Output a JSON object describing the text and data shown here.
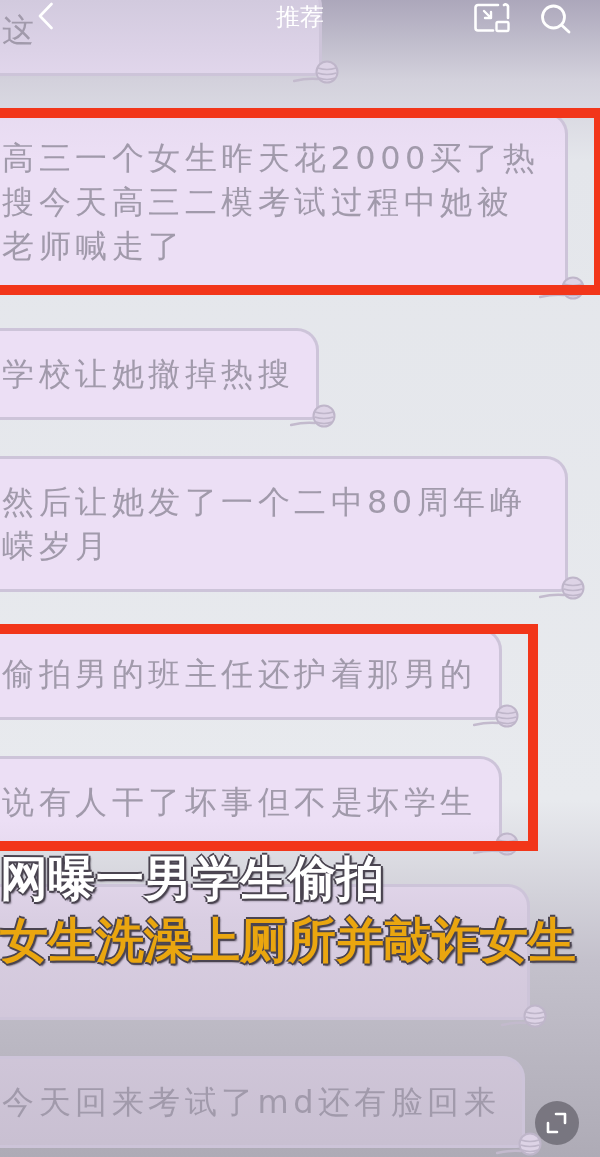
{
  "top_bar": {
    "title": "推荐"
  },
  "sections": [
    {
      "highlighted": false,
      "messages": [
        {
          "kind": "text",
          "text": "这"
        }
      ]
    },
    {
      "highlighted": true,
      "messages": [
        {
          "kind": "text",
          "text": "高三一个女生昨天花2000买了热搜今天高三二模考试过程中她被老师喊走了"
        }
      ]
    },
    {
      "highlighted": false,
      "messages": [
        {
          "kind": "text",
          "text": "学校让她撤掉热搜"
        },
        {
          "kind": "text",
          "text": "然后让她发了一个二中80周年峥嵘岁月"
        }
      ]
    },
    {
      "highlighted": true,
      "messages": [
        {
          "kind": "text",
          "text": "偷拍男的班主任还护着那男的"
        },
        {
          "kind": "text",
          "text": "说有人干了坏事但不是坏学生"
        }
      ]
    },
    {
      "highlighted": false,
      "messages": [
        {
          "kind": "covered"
        },
        {
          "kind": "text",
          "text": "今天回来考试了md还有脸回来"
        }
      ]
    }
  ],
  "caption": {
    "lines": [
      {
        "text": "网曝一男学生偷拍",
        "color": "#ffffff"
      },
      {
        "text": "女生洗澡上厕所并敲诈女生",
        "color": "#eaa60f"
      }
    ]
  }
}
